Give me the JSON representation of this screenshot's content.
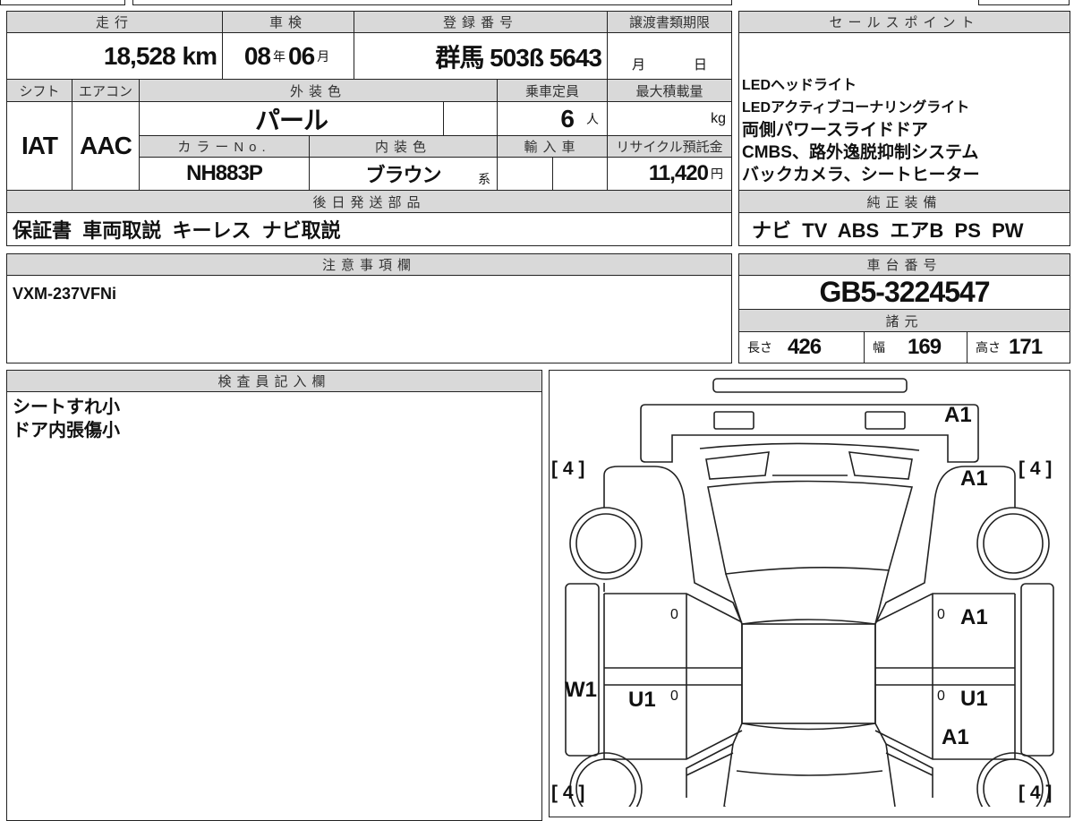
{
  "main": {
    "mileage_label": "走行",
    "mileage": "18,528",
    "mileage_unit": "km",
    "inspection_label": "車検",
    "inspection_year": "08",
    "year_unit": "年",
    "inspection_month": "06",
    "month_unit": "月",
    "registration_label": "登録番号",
    "registration": "群馬 503ß 5643",
    "transfer_deadline_label": "譲渡書類期限",
    "deadline_month_unit": "月",
    "deadline_day_unit": "日",
    "shift_label": "シフト",
    "shift": "IAT",
    "ac_label": "エアコン",
    "ac": "AAC",
    "exterior_color_label": "外装色",
    "exterior_color": "パール",
    "capacity_label": "乗車定員",
    "capacity": "6",
    "capacity_unit": "人",
    "max_load_label": "最大積載量",
    "max_load_unit": "kg",
    "color_no_label": "カラーNo.",
    "color_no": "NH883P",
    "interior_color_label": "内装色",
    "interior_color": "ブラウン",
    "interior_suffix": "系",
    "import_label": "輸入車",
    "recycle_label": "リサイクル預託金",
    "recycle_fee": "11,420",
    "recycle_unit": "円",
    "later_parts_label": "後日発送部品",
    "later_parts": "保証書  車両取説  キーレス  ナビ取説",
    "notes_label": "注意事項欄",
    "notes": "VXM-237VFNi"
  },
  "sales_points": {
    "label": "セールスポイント",
    "items": [
      "LEDヘッドライト",
      "LEDアクティブコーナリングライト",
      "両側パワースライドドア",
      "CMBS、路外逸脱抑制システム",
      "バックカメラ、シートヒーター"
    ]
  },
  "equipment": {
    "label": "純正装備",
    "value": "ナビ  TV  ABS  エアB  PS  PW"
  },
  "chassis": {
    "label": "車台番号",
    "value": "GB5-3224547"
  },
  "specs": {
    "label": "諸元",
    "length_label": "長さ",
    "length": "426",
    "width_label": "幅",
    "width": "169",
    "height_label": "高さ",
    "height": "171"
  },
  "inspector": {
    "label": "検査員記入欄",
    "lines": [
      "シートすれ小",
      "ドア内張傷小"
    ]
  },
  "diagram": {
    "marks": {
      "front_bumper": "A1",
      "front_right_fender": "A1",
      "right_front_door": "A1",
      "right_rear_door": "U1",
      "right_rear_fender": "A1",
      "left_rear_door": "U1",
      "left_sill": "W1",
      "door_zero_1": "0",
      "door_zero_2": "0",
      "door_zero_3": "0",
      "door_zero_4": "0"
    },
    "tread": {
      "front_left": "[ 4 ]",
      "front_right": "[ 4 ]",
      "rear_left": "[ 4 ]",
      "rear_right": "[ 4 ]"
    }
  }
}
